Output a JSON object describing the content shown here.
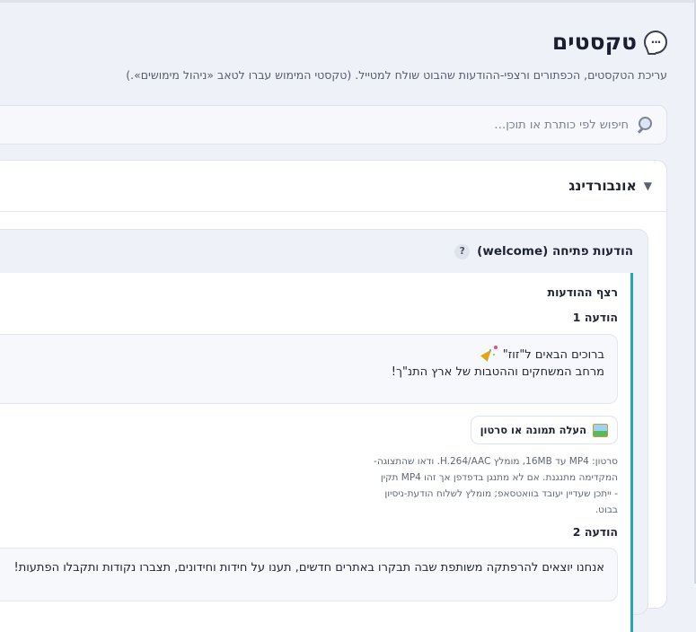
{
  "page": {
    "title": "טקסטים",
    "subtitle": "עריכת הטקסטים, הכפתורים ורצפי-ההודעות שהבוט שולח למטייל. (טקסטי המימוש עברו לטאב «ניהול מימושים».)"
  },
  "search": {
    "placeholder": "חיפוש לפי כותרת או תוכן…"
  },
  "section": {
    "title": "אונבורדינג",
    "caret": "▼"
  },
  "subsection": {
    "title": "הודעות פתיחה (welcome)",
    "help": "?"
  },
  "sequence": {
    "title": "רצף ההודעות",
    "messages": [
      {
        "label": "הודעה 1",
        "line1": "ברוכים הבאים ל\"זוז\"",
        "line2": "מרחב המשחקים וההטבות של ארץ התנ\"ך!"
      },
      {
        "label": "הודעה 2",
        "line1": "אנחנו יוצאים להרפתקה משותפת שבה תבקרו באתרים חדשים, תענו על חידות וחידונים, תצברו נקודות ותקבלו הפתעות!"
      }
    ],
    "upload_label": "העלה תמונה או סרטון",
    "hint_lines": [
      "סרטון: MP4 עד 16MB, מומלץ H.264/AAC. ודאו שהתצוגה-",
      "המקדימה מתנגנת. אם לא מתנגן בדפדפן אך זהו MP4 תקין",
      "- ייתכן שעדיין יעובד בוואטסאפ; מומלץ לשלוח הודעת-ניסיון",
      "בבוט."
    ]
  }
}
